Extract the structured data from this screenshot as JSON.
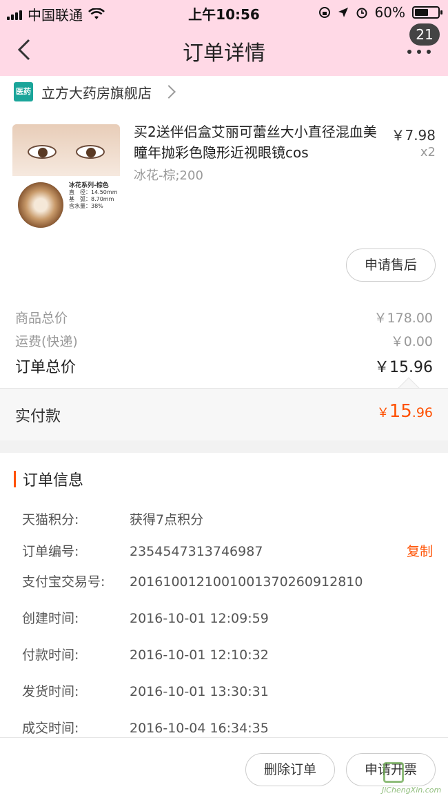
{
  "status": {
    "carrier": "中国联通",
    "time": "上午10:56",
    "battery": "60%",
    "battery_level": 0.6
  },
  "nav": {
    "title": "订单详情",
    "badge": "21"
  },
  "store": {
    "logo_text": "医药",
    "name": "立方大药房旗舰店"
  },
  "product": {
    "title": "买2送伴侣盒艾丽可蕾丝大小直径混血美瞳年抛彩色隐形近视眼镜cos",
    "spec": "冰花-棕;200",
    "price": "￥7.98",
    "qty": "x2",
    "thumb_text": {
      "series": "冰花系列-棕色",
      "line1": "直　径：14.50mm",
      "line2": "基　弧：8.70mm",
      "line3": "含水量：38%"
    },
    "after_sale_label": "申请售后"
  },
  "totals": {
    "goods_label": "商品总价",
    "goods_value": "￥178.00",
    "shipping_label": "运费(快递)",
    "shipping_value": "￥0.00",
    "order_label": "订单总价",
    "order_value": "￥15.96"
  },
  "paid": {
    "label": "实付款",
    "currency": "￥",
    "int": "15",
    "dec": ".96"
  },
  "order_info": {
    "title": "订单信息",
    "copy_label": "复制",
    "rows": [
      {
        "key": "天猫积分:",
        "value": "获得7点积分"
      },
      {
        "key": "订单编号:",
        "value": "2354547313746987"
      },
      {
        "key": "支付宝交易号:",
        "value": "2016100121001001370260912810"
      },
      {
        "key": "创建时间:",
        "value": "2016-10-01 12:09:59"
      },
      {
        "key": "付款时间:",
        "value": "2016-10-01 12:10:32"
      },
      {
        "key": "发货时间:",
        "value": "2016-10-01 13:30:31"
      },
      {
        "key": "成交时间:",
        "value": "2016-10-04 16:34:35"
      }
    ]
  },
  "bottom": {
    "delete_label": "删除订单",
    "invoice_label": "申请开票"
  },
  "watermark": {
    "url": "JiChengXin.com"
  }
}
